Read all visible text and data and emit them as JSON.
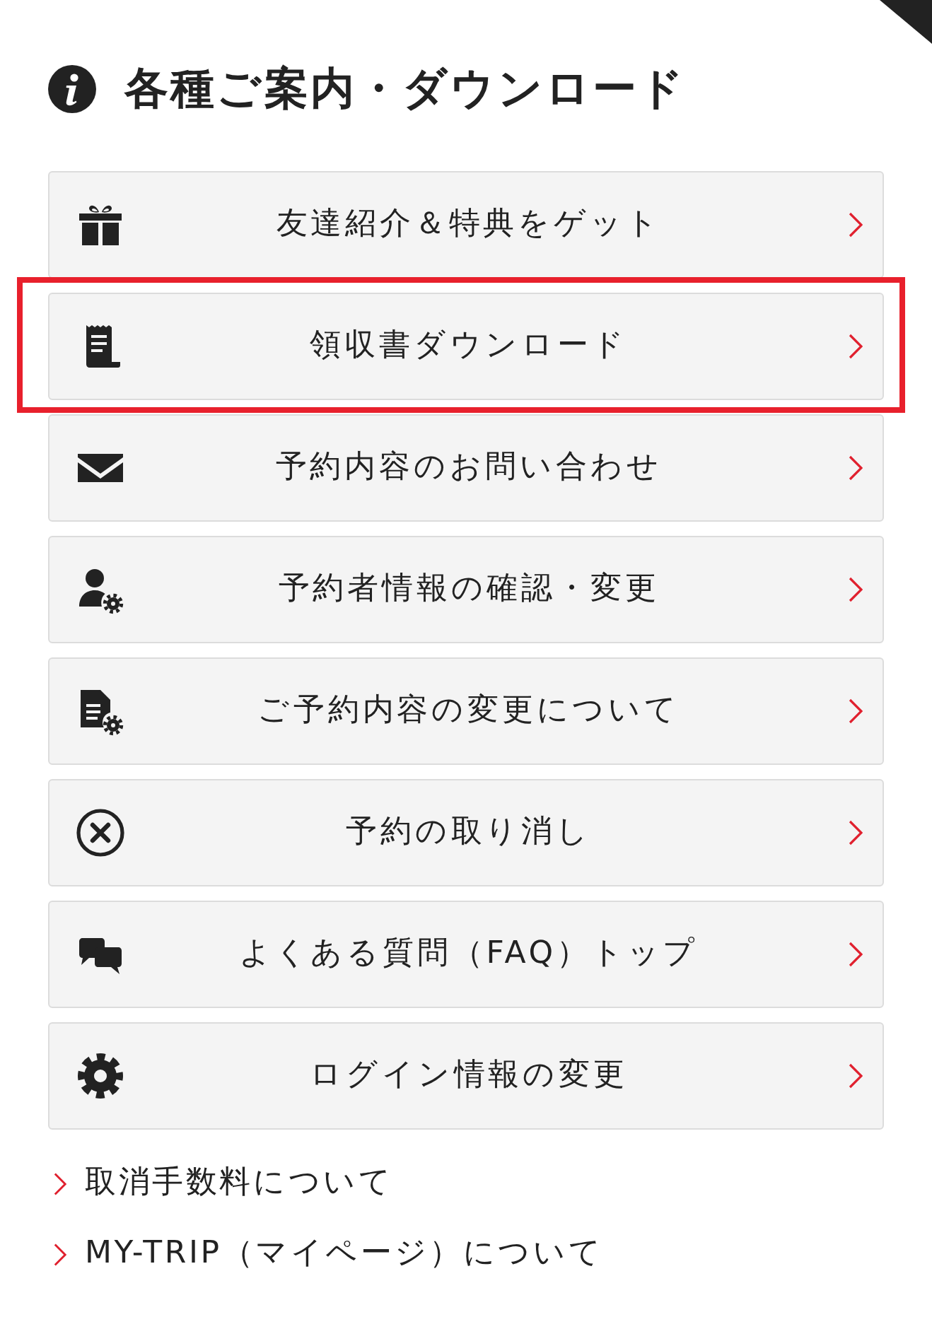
{
  "header": {
    "title": "各種ご案内・ダウンロード"
  },
  "menu": [
    {
      "label": "友達紹介＆特典をゲット",
      "highlighted": false
    },
    {
      "label": "領収書ダウンロード",
      "highlighted": true
    },
    {
      "label": "予約内容のお問い合わせ",
      "highlighted": false
    },
    {
      "label": "予約者情報の確認・変更",
      "highlighted": false
    },
    {
      "label": "ご予約内容の変更について",
      "highlighted": false
    },
    {
      "label": "予約の取り消し",
      "highlighted": false
    },
    {
      "label": "よくある質問（FAQ）トップ",
      "highlighted": false
    },
    {
      "label": "ログイン情報の変更",
      "highlighted": false
    }
  ],
  "links": [
    {
      "label": "取消手数料について"
    },
    {
      "label": "MY-TRIP（マイページ）について"
    }
  ]
}
